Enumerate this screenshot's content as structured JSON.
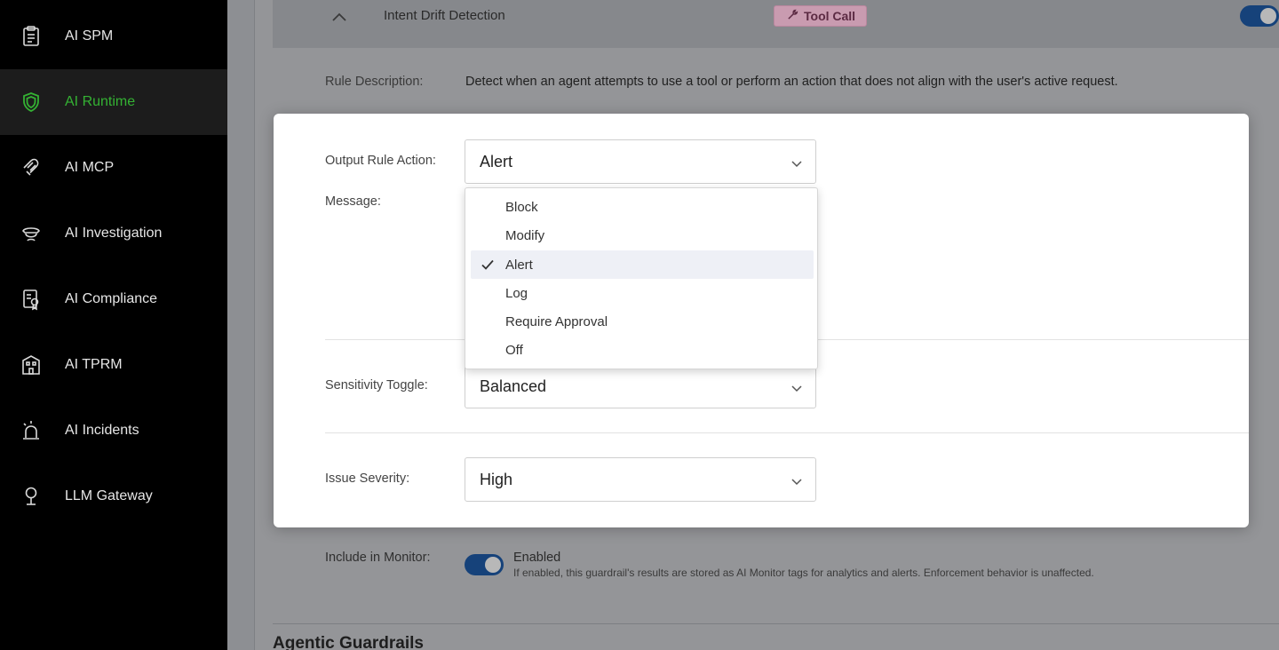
{
  "sidebar": {
    "items": [
      {
        "label": "AI SPM",
        "icon": "clipboard-icon",
        "active": false
      },
      {
        "label": "AI Runtime",
        "icon": "shield-icon",
        "active": true
      },
      {
        "label": "AI MCP",
        "icon": "mcp-icon",
        "active": false
      },
      {
        "label": "AI Investigation",
        "icon": "investigator-icon",
        "active": false
      },
      {
        "label": "AI Compliance",
        "icon": "compliance-icon",
        "active": false
      },
      {
        "label": "AI TPRM",
        "icon": "building-icon",
        "active": false
      },
      {
        "label": "AI Incidents",
        "icon": "siren-icon",
        "active": false
      },
      {
        "label": "LLM Gateway",
        "icon": "gateway-icon",
        "active": false
      }
    ]
  },
  "rule": {
    "title": "Intent Drift Detection",
    "badge": "Tool Call",
    "enabled": true,
    "description_label": "Rule Description:",
    "description": "Detect when an agent attempts to use a tool or perform an action that does not align with the user's active request."
  },
  "modal": {
    "output_action_label": "Output Rule Action:",
    "output_action_value": "Alert",
    "message_label": "Message:",
    "sensitivity_label": "Sensitivity Toggle:",
    "sensitivity_value": "Balanced",
    "severity_label": "Issue Severity:",
    "severity_value": "High"
  },
  "dropdown": {
    "options": [
      "Block",
      "Modify",
      "Alert",
      "Log",
      "Require Approval",
      "Off"
    ],
    "selected": "Alert"
  },
  "monitor": {
    "label": "Include in Monitor:",
    "status": "Enabled",
    "enabled": true,
    "help": "If enabled, this guardrail's results are stored as AI Monitor tags for analytics and alerts. Enforcement behavior is unaffected."
  },
  "section": {
    "title": "Agentic Guardrails"
  },
  "colors": {
    "accent": "#34b233",
    "toggle": "#1565c0",
    "badge_bg": "#c99bb0",
    "selected_option_bg": "#eef0f6"
  }
}
